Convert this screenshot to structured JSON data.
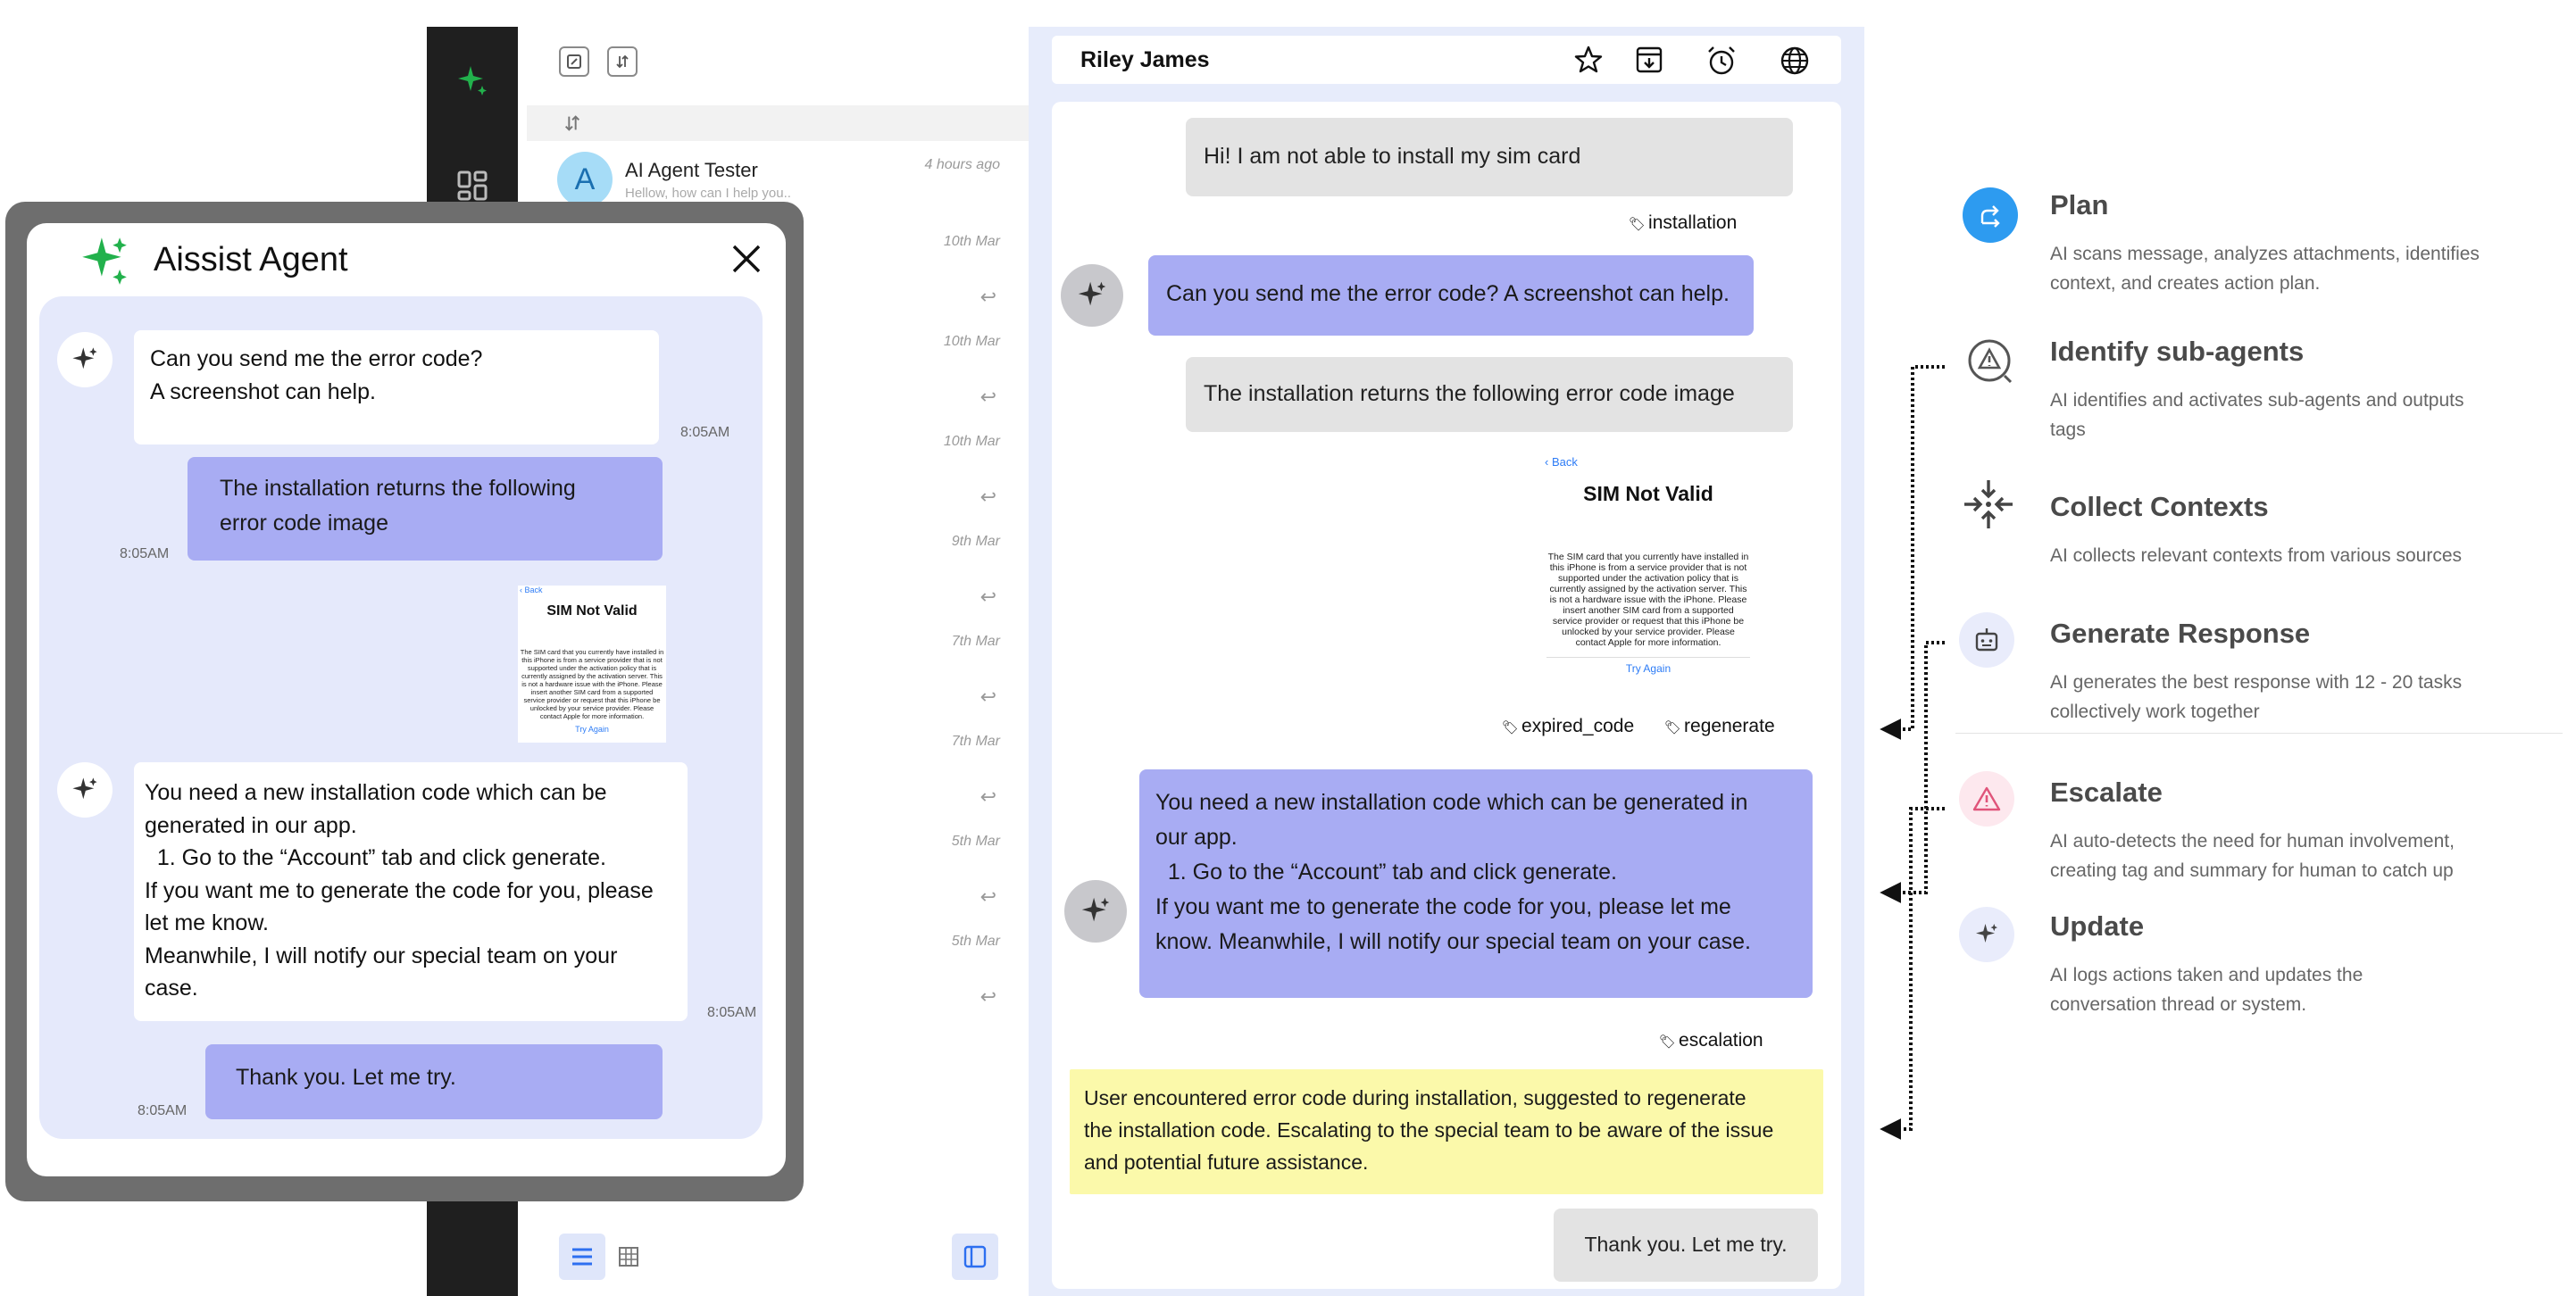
{
  "inbox": {
    "first": {
      "avatar_letter": "A",
      "name": "AI Agent Tester",
      "preview": "Hellow, how can I help you..",
      "time": "4 hours ago"
    },
    "dates": [
      "10th Mar",
      "10th Mar",
      "10th Mar",
      "9th Mar",
      "7th Mar",
      "7th Mar",
      "5th Mar",
      "5th Mar"
    ],
    "reply_glyph": "↩"
  },
  "conversation": {
    "contact_name": "Riley James",
    "messages": {
      "m1": "Hi! I am not able to install my sim card",
      "m2": "Can you send me the error code? A screenshot can help.",
      "m3": "The installation returns the following error code image",
      "m4_lines": [
        "You need a new installation code which can be generated in",
        "our app.",
        "  1. Go to the “Account” tab and click generate.",
        "If you want me to generate the code for you, please let me",
        "know. Meanwhile, I will notify our special team on your case."
      ],
      "summary_lines": [
        "User encountered error code during installation, suggested to regenerate",
        "the installation code. Escalating to the special team to be aware of the issue",
        "and potential future assistance."
      ],
      "m6": "Thank you. Let me try."
    },
    "tags": {
      "installation": "installation",
      "expired_code": "expired_code",
      "regenerate": "regenerate",
      "escalation": "escalation"
    },
    "screenshot": {
      "back": "Back",
      "title": "SIM Not Valid",
      "body_lines": [
        "The SIM card that you currently have installed in",
        "this iPhone is from a service provider that is not",
        "supported under the activation policy that is",
        "currently assigned by the activation server. This",
        "is not a hardware issue with the iPhone. Please",
        "insert another SIM card from a supported",
        "service provider or request that this iPhone be",
        "unlocked by your service provider. Please",
        "contact Apple for more information."
      ],
      "button": "Try Again"
    }
  },
  "aissist": {
    "title": "Aissist Agent",
    "msg1_lines": [
      "Can you send me the error code?",
      "A screenshot can help."
    ],
    "msg2_lines": [
      "The installation returns the following",
      "error code image"
    ],
    "msg3_lines": [
      "You need a new installation code which can be",
      "generated in our app.",
      "  1. Go to the “Account” tab and click generate.",
      "If you want me to generate the code for you, please",
      "let me know.",
      "Meanwhile, I will notify our special team on your",
      "case."
    ],
    "msg4": "Thank you. Let me try.",
    "times": {
      "t1": "8:05AM",
      "t2": "8:05AM",
      "t3": "8:05AM",
      "t4": "8:05AM"
    }
  },
  "steps": [
    {
      "title": "Plan",
      "desc_lines": [
        "AI scans message, analyzes attachments, identifies",
        "context, and creates action plan."
      ],
      "icon": "branch-arrows-icon",
      "color": "#2d9bf0"
    },
    {
      "title": "Identify sub-agents",
      "desc_lines": [
        "AI identifies and activates sub-agents and outputs",
        "tags"
      ],
      "icon": "warning-search-icon",
      "color": "#555555"
    },
    {
      "title": "Collect Contexts",
      "desc_lines": [
        "AI collects relevant contexts from various sources"
      ],
      "icon": "collapse-arrows-icon",
      "color": "#444444"
    },
    {
      "title": "Generate Response",
      "desc_lines": [
        "AI generates the best response with 12 - 20 tasks",
        "collectively work together"
      ],
      "icon": "robot-icon",
      "color": "#e9ecfb"
    },
    {
      "title": "Escalate",
      "desc_lines": [
        "AI auto-detects the need for human involvement,",
        "creating tag and summary for human to catch up"
      ],
      "icon": "alert-triangle-icon",
      "color": "#fde8ee"
    },
    {
      "title": "Update",
      "desc_lines": [
        "AI logs actions taken and updates the",
        "conversation thread or system."
      ],
      "icon": "sparkle-icon",
      "color": "#e9ecfb"
    }
  ],
  "colors": {
    "accent_green": "#22b14c",
    "bubble_purple": "#a8acf3",
    "summary_yellow": "#fbf9aa",
    "plan_blue": "#2d9bf0",
    "panel_bg": "#e7ecfb"
  }
}
